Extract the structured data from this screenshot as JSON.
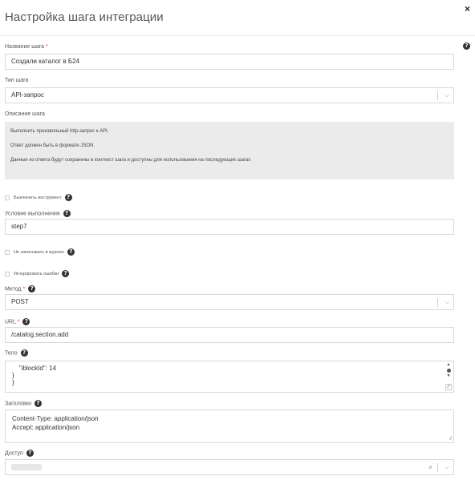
{
  "header": {
    "title": "Настройка шага интеграции",
    "close_label": "×"
  },
  "fields": {
    "step_name": {
      "label": "Название шага",
      "required_mark": "*",
      "value": "Создали каталог в Б24"
    },
    "step_type": {
      "label": "Тип шага",
      "value": "API-запрос"
    },
    "description": {
      "label": "Описание шага",
      "lines": [
        "Выполнить произвольный http-запрос к API.",
        "Ответ должен быть в формате JSON.",
        "Данные из ответа будут сохранены в контекст шага и доступны для использования на последующих шагах"
      ]
    },
    "disable_tool": {
      "label": "Выключить инструмент",
      "checked": false
    },
    "condition": {
      "label": "Условие выполнения",
      "value": "step7"
    },
    "no_log": {
      "label": "Не записывать в журнал",
      "checked": false
    },
    "ignore_errors": {
      "label": "Игнорировать ошибки",
      "checked": false
    },
    "method": {
      "label": "Метод",
      "required_mark": "*",
      "value": "POST"
    },
    "url": {
      "label": "URL",
      "required_mark": "*",
      "value": "/catalog.section.add"
    },
    "body": {
      "label": "Тело",
      "lines": [
        "    \"iblockId\": 14",
        "}",
        "}"
      ]
    },
    "headers": {
      "label": "Заголовки",
      "lines": [
        "Content-Type: application/json",
        "Accept: application/json"
      ]
    },
    "access": {
      "label": "Доступ",
      "clear_label": "×"
    }
  },
  "icons": {
    "help": "?",
    "chevron": "⌵"
  }
}
